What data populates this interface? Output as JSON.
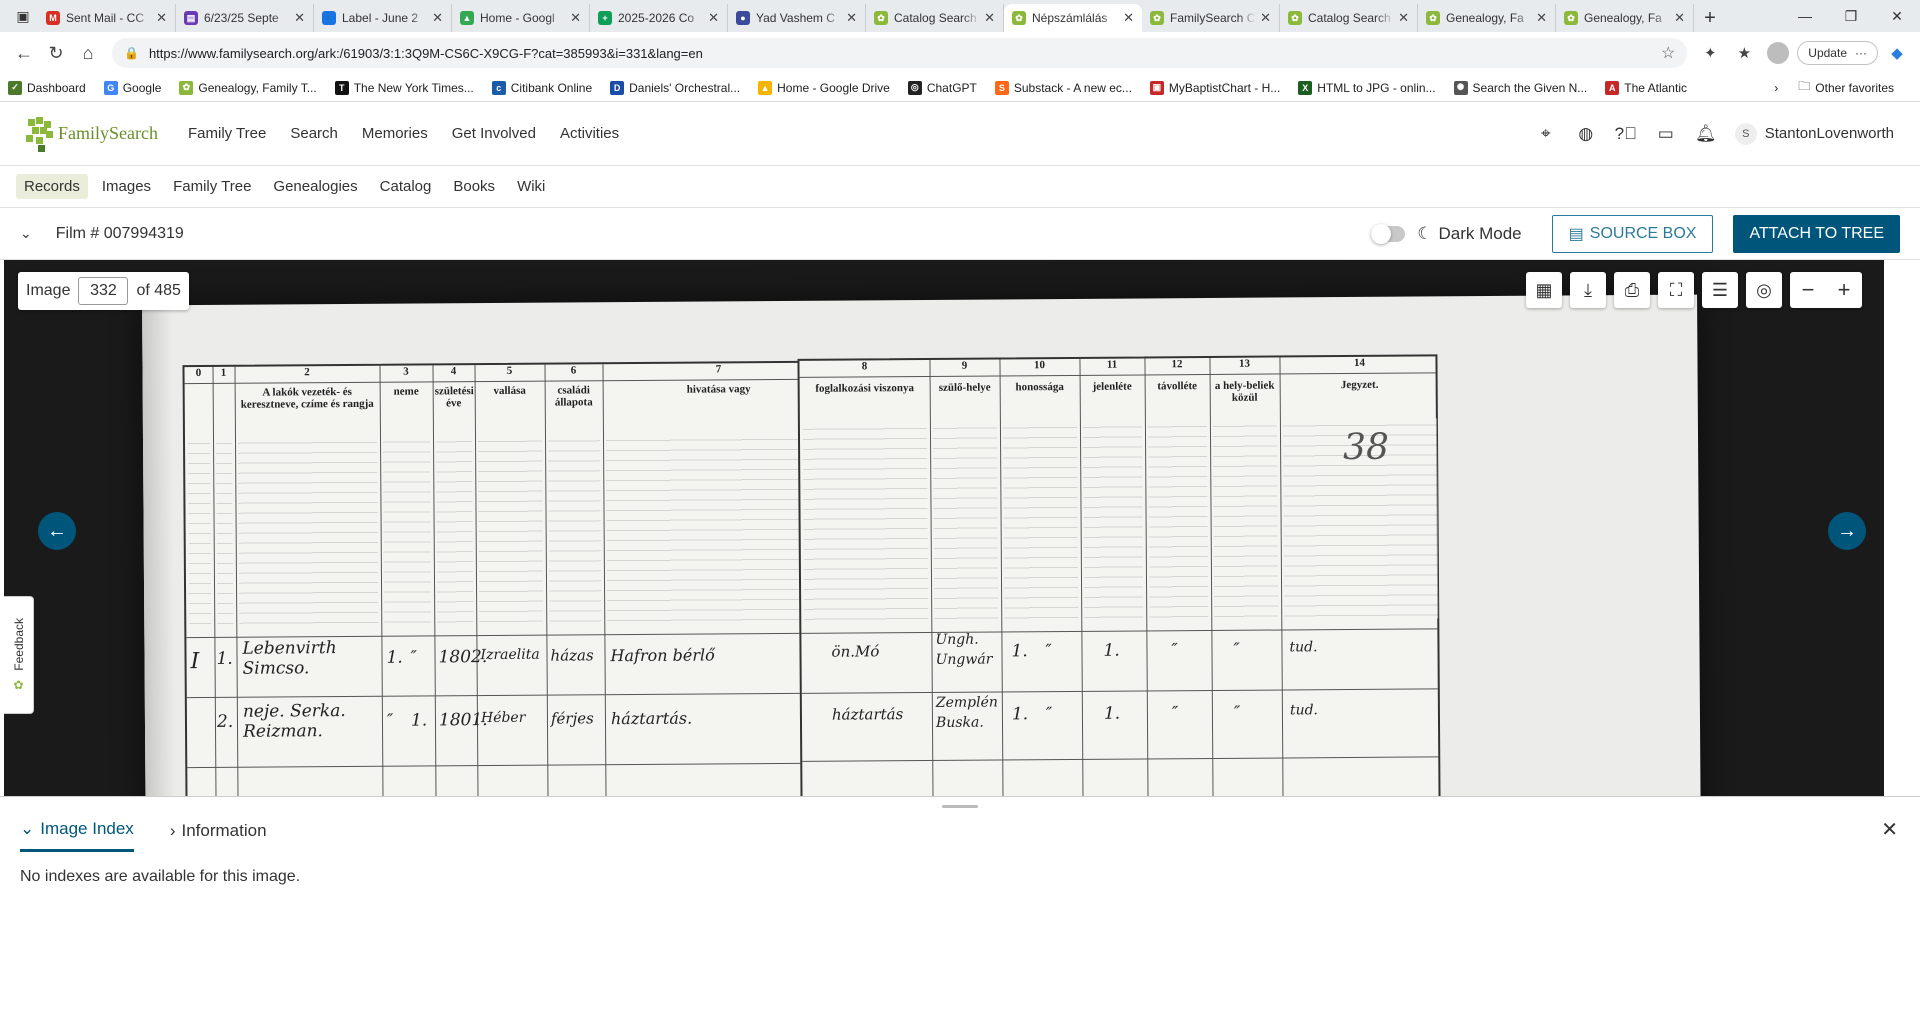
{
  "browser": {
    "tabs": [
      {
        "label": "Sent Mail - CC",
        "color": "#d93025",
        "glyph": "M",
        "active": false
      },
      {
        "label": "6/23/25 Septe",
        "color": "#6a3ab2",
        "glyph": "▤",
        "active": false
      },
      {
        "label": "Label - June 2",
        "color": "#1a73e8",
        "glyph": "👤",
        "active": false
      },
      {
        "label": "Home - Googl",
        "color": "#34a853",
        "glyph": "▲",
        "active": false
      },
      {
        "label": "2025-2026 Co",
        "color": "#0f9d58",
        "glyph": "+",
        "active": false
      },
      {
        "label": "Yad Vashem C",
        "color": "#3c4a9a",
        "glyph": "●",
        "active": false
      },
      {
        "label": "Catalog Search",
        "color": "#8cb83c",
        "glyph": "✿",
        "active": false
      },
      {
        "label": "Népszámlálás",
        "color": "#8cb83c",
        "glyph": "✿",
        "active": true
      },
      {
        "label": "FamilySearch C",
        "color": "#8cb83c",
        "glyph": "✿",
        "active": false
      },
      {
        "label": "Catalog Search",
        "color": "#8cb83c",
        "glyph": "✿",
        "active": false
      },
      {
        "label": "Genealogy, Fa",
        "color": "#8cb83c",
        "glyph": "✿",
        "active": false
      },
      {
        "label": "Genealogy, Fa",
        "color": "#8cb83c",
        "glyph": "✿",
        "active": false
      }
    ],
    "url": "https://www.familysearch.org/ark:/61903/3:1:3Q9M-CS6C-X9CG-F?cat=385993&i=331&lang=en",
    "update_label": "Update",
    "bookmarks": [
      {
        "label": "Dashboard",
        "color": "#4a7a2a",
        "glyph": "✓"
      },
      {
        "label": "Google",
        "color": "#4285f4",
        "glyph": "G"
      },
      {
        "label": "Genealogy, Family T...",
        "color": "#8cb83c",
        "glyph": "✿"
      },
      {
        "label": "The New York Times...",
        "color": "#111",
        "glyph": "T"
      },
      {
        "label": "Citibank Online",
        "color": "#1a5ca8",
        "glyph": "c"
      },
      {
        "label": "Daniels' Orchestral...",
        "color": "#1a4da8",
        "glyph": "D"
      },
      {
        "label": "Home - Google Drive",
        "color": "#f4b400",
        "glyph": "▲"
      },
      {
        "label": "ChatGPT",
        "color": "#222",
        "glyph": "◎"
      },
      {
        "label": "Substack - A new ec...",
        "color": "#ff6719",
        "glyph": "S"
      },
      {
        "label": "MyBaptistChart - H...",
        "color": "#c62828",
        "glyph": "▣"
      },
      {
        "label": "HTML to JPG - onlin...",
        "color": "#1b5e20",
        "glyph": "X"
      },
      {
        "label": "Search the Given N...",
        "color": "#555",
        "glyph": "✺"
      },
      {
        "label": "The Atlantic",
        "color": "#c62828",
        "glyph": "A"
      }
    ],
    "other_favorites": "Other favorites"
  },
  "fs": {
    "logo": "FamilySearch",
    "nav": [
      "Family Tree",
      "Search",
      "Memories",
      "Get Involved",
      "Activities"
    ],
    "user_initial": "S",
    "username": "StantonLovenworth",
    "subnav": [
      "Records",
      "Images",
      "Family Tree",
      "Genealogies",
      "Catalog",
      "Books",
      "Wiki"
    ],
    "film": "Film # 007994319",
    "dark_mode": "Dark Mode",
    "source_box": "SOURCE BOX",
    "attach": "ATTACH TO TREE"
  },
  "viewer": {
    "image_label": "Image",
    "image_number": "332",
    "of_label": "of 485",
    "feedback": "Feedback"
  },
  "census": {
    "left_cols": [
      "0",
      "1",
      "2",
      "3",
      "4",
      "5",
      "6",
      "7"
    ],
    "left_heads": [
      "",
      "",
      "A lakók vezeték- és keresztneve, czíme és rangja",
      "neme",
      "születési éve",
      "vallása",
      "családi állapota",
      "hivatása vagy"
    ],
    "right_cols": [
      "8",
      "9",
      "10",
      "11",
      "12",
      "13",
      "14"
    ],
    "right_heads": [
      "foglalkozási viszonya",
      "szülő-helye",
      "honossága",
      "jelenléte",
      "távolléte",
      "a hely-beliek közül",
      "Jegyzet."
    ],
    "margin_note": "38",
    "rows": [
      {
        "num": "I",
        "sub": "1.",
        "name": "Lebenvirth Simcso.",
        "sex_m": "1.",
        "sex_f": "″",
        "year": "1802.",
        "religion": "Izraelita",
        "status": "házas",
        "job": "Hafron bérlő",
        "occ": "ön.Mó",
        "birth": "Ungh. Ungwár",
        "hon": "1.",
        "h2": "″",
        "pres": "1.",
        "pres2": "″",
        "abs": "″",
        "lit": "tud."
      },
      {
        "num": "",
        "sub": "2.",
        "name": "neje. Serka. Reizman.",
        "sex_m": "″",
        "sex_f": "1.",
        "year": "1801.",
        "religion": "Héber",
        "status": "férjes",
        "job": "háztartás.",
        "occ": "háztartás",
        "birth": "Zemplén Buska.",
        "hon": "1.",
        "h2": "″",
        "pres": "1.",
        "pres2": "″",
        "abs": "″",
        "lit": "tud."
      }
    ]
  },
  "panel": {
    "tab_index": "Image Index",
    "tab_info": "Information",
    "message": "No indexes are available for this image."
  }
}
